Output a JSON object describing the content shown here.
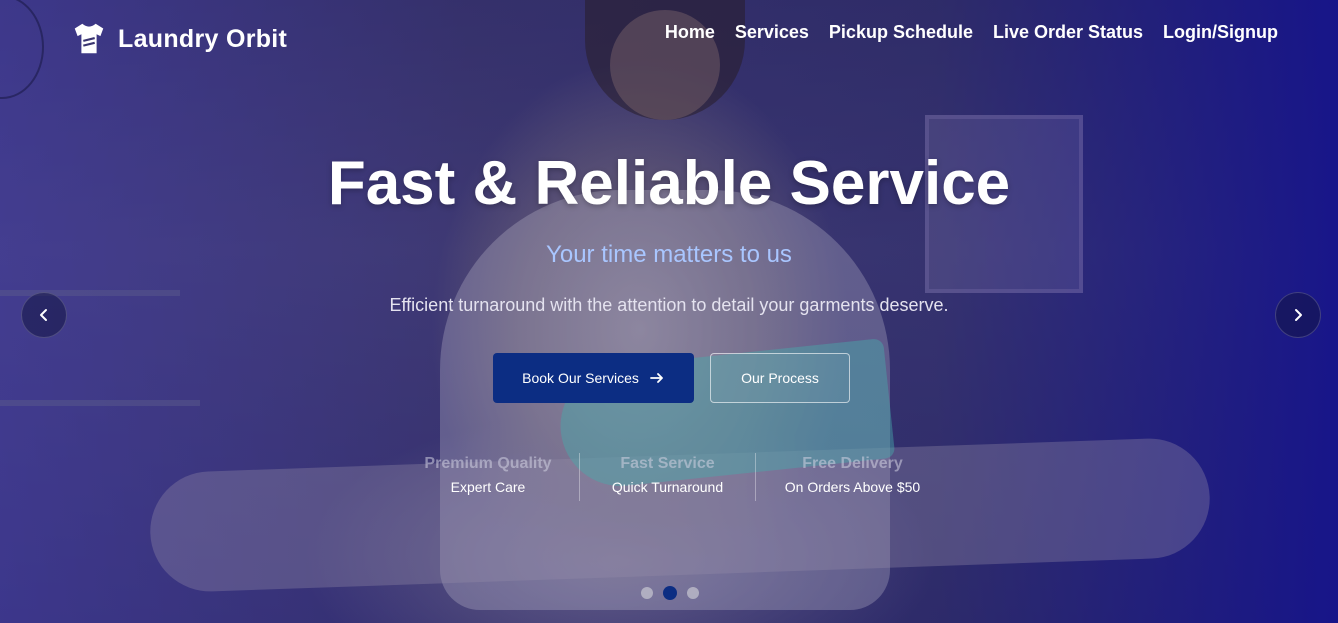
{
  "brand": {
    "name": "Laundry Orbit",
    "icon": "tshirt-icon"
  },
  "nav": {
    "items": [
      {
        "label": "Home"
      },
      {
        "label": "Services"
      },
      {
        "label": "Pickup Schedule"
      },
      {
        "label": "Live Order Status"
      },
      {
        "label": "Login/Signup"
      }
    ]
  },
  "hero": {
    "title": "Fast & Reliable Service",
    "subtitle": "Your time matters to us",
    "description": "Efficient turnaround with the attention to detail your garments deserve.",
    "primary_button": {
      "label": "Book Our Services",
      "icon": "arrow-right-icon"
    },
    "secondary_button": {
      "label": "Our Process"
    }
  },
  "features": [
    {
      "title": "Premium Quality",
      "subtitle": "Expert Care"
    },
    {
      "title": "Fast Service",
      "subtitle": "Quick Turnaround"
    },
    {
      "title": "Free Delivery",
      "subtitle": "On Orders Above $50"
    }
  ],
  "carousel": {
    "prev_icon": "chevron-left-icon",
    "next_icon": "chevron-right-icon",
    "slide_count": 3,
    "active_slide": 2
  },
  "colors": {
    "accent": "#0c2d83",
    "subtitle": "#a9c6ff",
    "overlay": "#1e1a8c"
  }
}
